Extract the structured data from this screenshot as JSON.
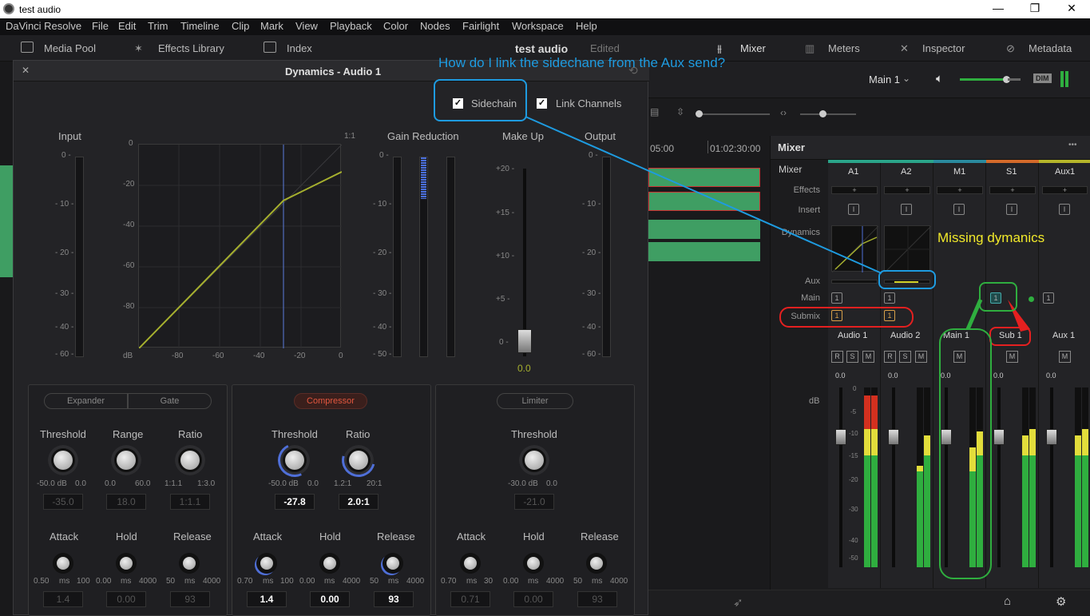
{
  "window": {
    "title": "test audio",
    "min": "—",
    "restore": "❐",
    "close": "✕"
  },
  "menu": [
    "DaVinci Resolve",
    "File",
    "Edit",
    "Trim",
    "Timeline",
    "Clip",
    "Mark",
    "View",
    "Playback",
    "Color",
    "Nodes",
    "Fairlight",
    "Workspace",
    "Help"
  ],
  "toolbar": {
    "media_pool": "Media Pool",
    "effects_library": "Effects Library",
    "index": "Index",
    "project": "test audio",
    "edited": "Edited",
    "mixer": "Mixer",
    "meters": "Meters",
    "inspector": "Inspector",
    "metadata": "Metadata"
  },
  "monitor": {
    "bus": "Main 1",
    "dim": "DIM"
  },
  "timeline": {
    "tc1": "05:00",
    "tc2": "01:02:30:00"
  },
  "annotations": {
    "question": "How do I link the sidechane from the Aux send?",
    "missing": "Missing dymanics"
  },
  "dynamics": {
    "title": "Dynamics - Audio 1",
    "close": "✕",
    "sidechain": "Sidechain",
    "link_channels": "Link Channels",
    "input": "Input",
    "gain_reduction": "Gain Reduction",
    "make_up": "Make Up",
    "output": "Output",
    "one_to_one": "1:1",
    "graph_y": [
      "0",
      "-20",
      "-40",
      "-60",
      "-80"
    ],
    "graph_x": [
      "dB",
      "-80",
      "-60",
      "-40",
      "-20",
      "0"
    ],
    "meter_scale": [
      "0 -",
      "- 10 -",
      "- 20 -",
      "- 30 -",
      "- 40 -",
      "- 50 -",
      "- 60 -"
    ],
    "makeup_scale": [
      "+20 -",
      "+15 -",
      "+10 -",
      "+5 -",
      "0 -"
    ],
    "makeup_value": "0.0",
    "expander": {
      "tab1": "Expander",
      "tab2": "Gate",
      "threshold": "Threshold",
      "range": "Range",
      "ratio": "Ratio",
      "th_min": "-50.0 dB",
      "th_max": "0.0",
      "rg_min": "0.0",
      "rg_max": "60.0",
      "ra_min": "1:1.1",
      "ra_max": "1:3.0",
      "th_val": "-35.0",
      "rg_val": "18.0",
      "ra_val": "1:1.1",
      "attack": "Attack",
      "hold": "Hold",
      "release": "Release",
      "at_min": "0.50",
      "at_unit": "ms",
      "at_max": "100",
      "ho_min": "0.00",
      "ho_unit": "ms",
      "ho_max": "4000",
      "re_min": "50",
      "re_unit": "ms",
      "re_max": "4000",
      "at_val": "1.4",
      "ho_val": "0.00",
      "re_val": "93"
    },
    "compressor": {
      "tab": "Compressor",
      "threshold": "Threshold",
      "ratio": "Ratio",
      "th_min": "-50.0 dB",
      "th_max": "0.0",
      "ra_min": "1.2:1",
      "ra_max": "20:1",
      "th_val": "-27.8",
      "ra_val": "2.0:1",
      "attack": "Attack",
      "hold": "Hold",
      "release": "Release",
      "at_min": "0.70",
      "at_unit": "ms",
      "at_max": "100",
      "ho_min": "0.00",
      "ho_unit": "ms",
      "ho_max": "4000",
      "re_min": "50",
      "re_unit": "ms",
      "re_max": "4000",
      "at_val": "1.4",
      "ho_val": "0.00",
      "re_val": "93"
    },
    "limiter": {
      "tab": "Limiter",
      "threshold": "Threshold",
      "th_min": "-30.0 dB",
      "th_max": "0.0",
      "th_val": "-21.0",
      "attack": "Attack",
      "hold": "Hold",
      "release": "Release",
      "at_min": "0.70",
      "at_unit": "ms",
      "at_max": "30",
      "ho_min": "0.00",
      "ho_unit": "ms",
      "ho_max": "4000",
      "re_min": "50",
      "re_unit": "ms",
      "re_max": "4000",
      "at_val": "0.71",
      "ho_val": "0.00",
      "re_val": "93"
    }
  },
  "mixer": {
    "title": "Mixer",
    "more": "•••",
    "rows": {
      "effects": "Effects",
      "insert": "Insert",
      "dynamics": "Dynamics",
      "aux": "Aux",
      "main": "Main",
      "submix": "Submix",
      "db": "dB"
    },
    "channels": [
      {
        "id": "A1",
        "name": "Audio 1",
        "color": "#2aa58a",
        "level": "0.0",
        "main": "1",
        "submix": "1",
        "btns": [
          "R",
          "S",
          "M"
        ]
      },
      {
        "id": "A2",
        "name": "Audio 2",
        "color": "#2aa58a",
        "level": "0.0",
        "main": "1",
        "submix": "1",
        "btns": [
          "R",
          "S",
          "M"
        ]
      },
      {
        "id": "M1",
        "name": "Main 1",
        "color": "#2a8a9e",
        "level": "0.0",
        "main": "",
        "submix": "",
        "btns": [
          "M"
        ]
      },
      {
        "id": "S1",
        "name": "Sub 1",
        "color": "#d46a2a",
        "level": "0.0",
        "main": "1",
        "submix": "",
        "btns": [
          "M"
        ]
      },
      {
        "id": "Aux1",
        "name": "Aux 1",
        "color": "#b6b62a",
        "level": "0.0",
        "main": "1",
        "submix": "",
        "btns": [
          "M"
        ]
      }
    ],
    "plus": "+",
    "insert_btn": "I",
    "scale": [
      "0",
      "-5",
      "-10",
      "-15",
      "-20",
      "-30",
      "-40",
      "-50"
    ]
  }
}
